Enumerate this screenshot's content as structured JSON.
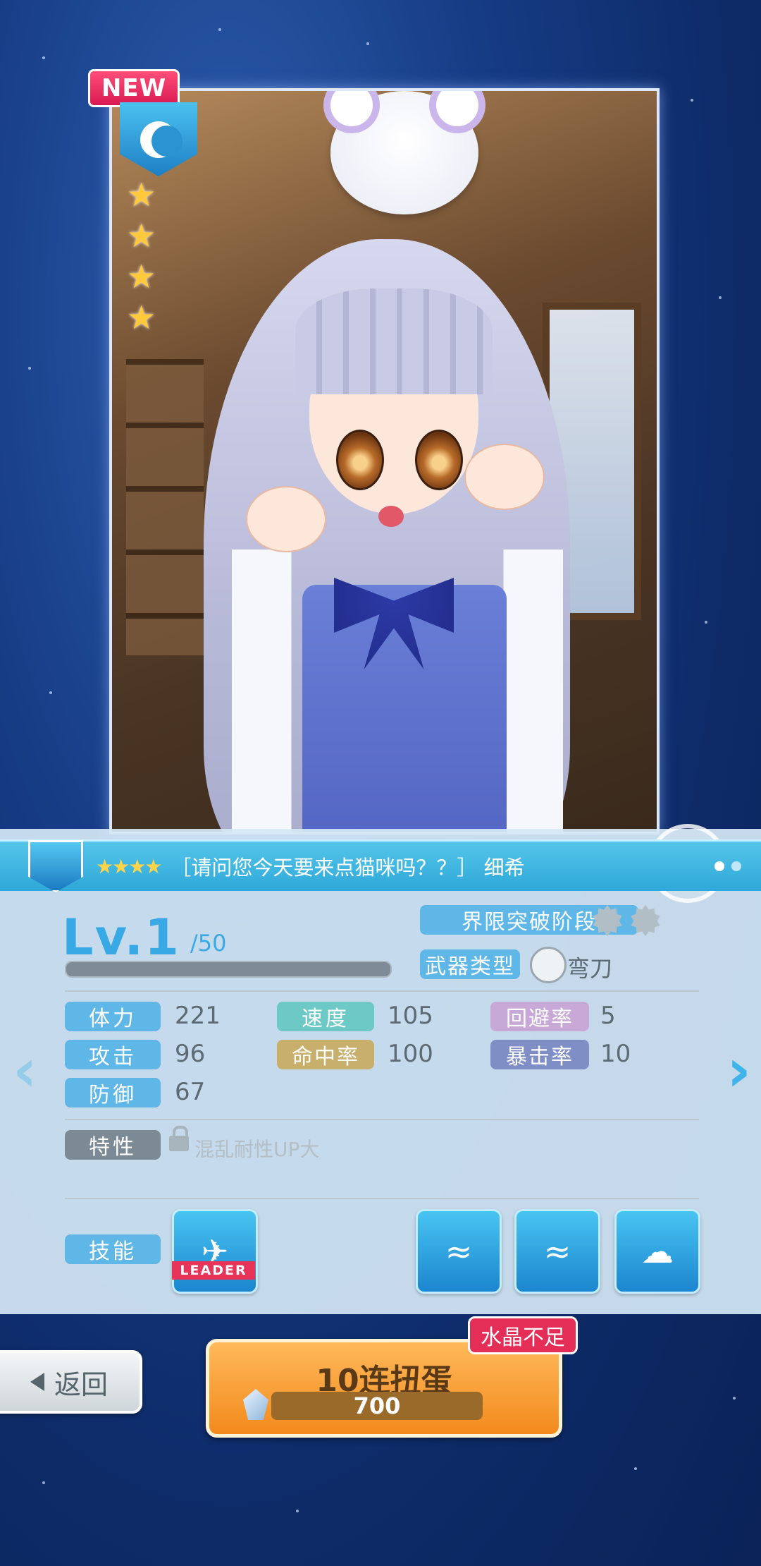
{
  "card": {
    "new_badge": "NEW",
    "rarity_stars": 4,
    "attribute_icon": "moon-clover-icon"
  },
  "header": {
    "stars": "★★★★",
    "name": "［请问您今天要来点猫咪吗？？］ 细希",
    "page_dots": 2,
    "active_dot": 0
  },
  "level": {
    "label": "Lv.1",
    "max": "/50",
    "exp_fraction": 1.0
  },
  "limit_break": {
    "label": "界限突破阶段",
    "stages": 2
  },
  "weapon": {
    "label": "武器类型",
    "value": "弯刀",
    "icon": "scimitar-icon"
  },
  "stats": {
    "hp": {
      "label": "体力",
      "value": "221"
    },
    "speed": {
      "label": "速度",
      "value": "105"
    },
    "evasion": {
      "label": "回避率",
      "value": "5"
    },
    "attack": {
      "label": "攻击",
      "value": "96"
    },
    "accuracy": {
      "label": "命中率",
      "value": "100"
    },
    "crit": {
      "label": "暴击率",
      "value": "10"
    },
    "defense": {
      "label": "防御",
      "value": "67"
    }
  },
  "trait": {
    "label": "特性",
    "value": "混乱耐性UP大",
    "locked": true
  },
  "skills": {
    "label": "技能",
    "leader_tag": "LEADER",
    "icons": [
      "leader-skill-icon",
      "wave-skill-icon",
      "wave-skill-up-icon",
      "cat-skill-icon"
    ]
  },
  "buttons": {
    "back": "返回",
    "gacha": "10连扭蛋",
    "gacha_cost": "700",
    "insufficient": "水晶不足"
  },
  "colors": {
    "accent": "#39a9e6",
    "gacha": "#f38a1d",
    "warn": "#e42e57"
  }
}
